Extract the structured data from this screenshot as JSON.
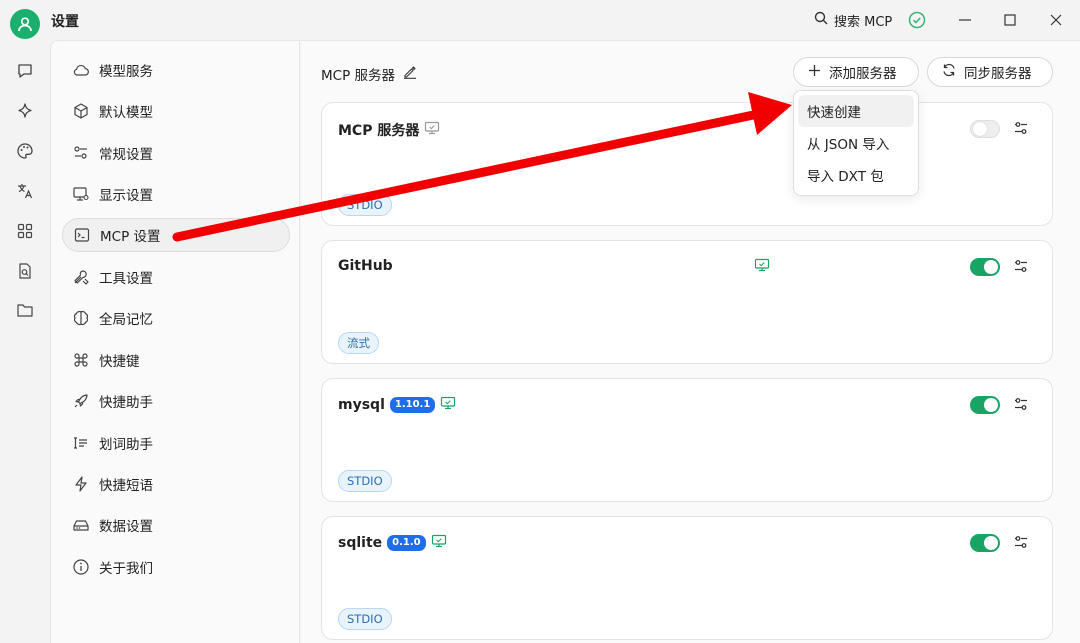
{
  "window": {
    "title": "设置",
    "search_label": "搜索 MCP",
    "icons": [
      "user-icon",
      "search-icon",
      "check-circle-icon",
      "minimize-icon",
      "maximize-icon",
      "close-icon"
    ]
  },
  "rail": {
    "icons": [
      "chat-icon",
      "sparkle-icon",
      "palette-icon",
      "translate-icon",
      "apps-icon",
      "document-search-icon",
      "folder-icon"
    ]
  },
  "settings_menu": {
    "items": [
      {
        "label": "模型服务",
        "icon": "cloud-icon"
      },
      {
        "label": "默认模型",
        "icon": "cube-icon"
      },
      {
        "label": "常规设置",
        "icon": "sliders-icon"
      },
      {
        "label": "显示设置",
        "icon": "monitor-gear-icon"
      },
      {
        "label": "MCP 设置",
        "icon": "terminal-icon",
        "active": true
      },
      {
        "label": "工具设置",
        "icon": "tools-icon"
      },
      {
        "label": "全局记忆",
        "icon": "brain-icon"
      },
      {
        "label": "快捷键",
        "icon": "command-icon"
      },
      {
        "label": "快捷助手",
        "icon": "rocket-icon"
      },
      {
        "label": "划词助手",
        "icon": "text-select-icon"
      },
      {
        "label": "快捷短语",
        "icon": "zap-icon"
      },
      {
        "label": "数据设置",
        "icon": "hard-drive-icon"
      },
      {
        "label": "关于我们",
        "icon": "info-icon"
      }
    ]
  },
  "main": {
    "title": "MCP 服务器",
    "add_server_label": "添加服务器",
    "sync_server_label": "同步服务器",
    "servers": [
      {
        "name": "MCP 服务器",
        "version": "",
        "tag": "STDIO",
        "enabled": false
      },
      {
        "name": "GitHub",
        "version": "",
        "tag": "流式",
        "enabled": true
      },
      {
        "name": "mysql",
        "version": "1.10.1",
        "tag": "STDIO",
        "enabled": true
      },
      {
        "name": "sqlite",
        "version": "0.1.0",
        "tag": "STDIO",
        "enabled": true
      }
    ]
  },
  "dropdown": {
    "items": [
      "快速创建",
      "从 JSON 导入",
      "导入 DXT 包"
    ]
  },
  "colors": {
    "accent_green": "#19a463",
    "arrow_red": "#f00000",
    "version_blue": "#1d6ee8"
  }
}
